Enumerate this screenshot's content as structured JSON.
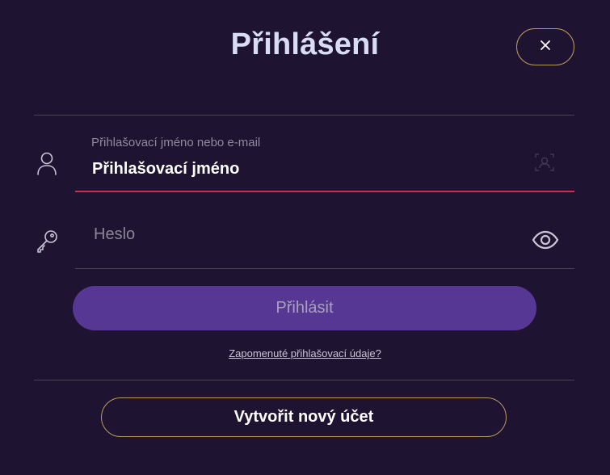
{
  "dialog": {
    "title": "Přihlášení",
    "close_icon": "close-icon"
  },
  "username": {
    "label": "Přihlašovací jméno nebo e-mail",
    "value": "Přihlašovací jméno",
    "icon": "user-icon",
    "autofill_icon": "contact-autofill-icon"
  },
  "password": {
    "placeholder": "Heslo",
    "icon": "key-icon",
    "toggle_icon": "eye-icon"
  },
  "actions": {
    "login_label": "Přihlásit",
    "forgot_label": "Zapomenuté přihlašovací údaje?",
    "create_account_label": "Vytvořit nový účet"
  },
  "colors": {
    "background": "#1e1331",
    "primary": "#573794",
    "accent_border": "#b99a5e",
    "error_underline": "#d42a4f"
  }
}
